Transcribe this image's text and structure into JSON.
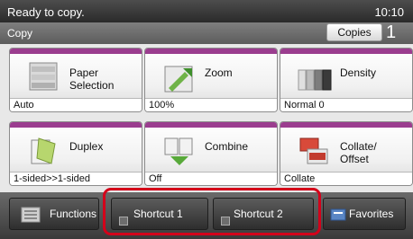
{
  "status": {
    "message": "Ready to copy.",
    "time": "10:10"
  },
  "title_bar": {
    "mode": "Copy",
    "copies_label": "Copies",
    "copies_count": "1"
  },
  "tiles": [
    {
      "label_line1": "Paper",
      "label_line2": "Selection",
      "value": "Auto",
      "icon": "paper-tray-icon"
    },
    {
      "label_line1": "Zoom",
      "label_line2": "",
      "value": "100%",
      "icon": "zoom-icon"
    },
    {
      "label_line1": "Density",
      "label_line2": "",
      "value": "Normal 0",
      "icon": "density-icon"
    },
    {
      "label_line1": "Duplex",
      "label_line2": "",
      "value": "1-sided>>1-sided",
      "icon": "duplex-icon"
    },
    {
      "label_line1": "Combine",
      "label_line2": "",
      "value": "Off",
      "icon": "combine-icon"
    },
    {
      "label_line1": "Collate/",
      "label_line2": "Offset",
      "value": "Collate",
      "icon": "collate-icon"
    }
  ],
  "bottom": {
    "functions": "Functions",
    "shortcut1": "Shortcut 1",
    "shortcut2": "Shortcut 2",
    "favorites": "Favorites"
  },
  "colors": {
    "accent": "#9b3d8f",
    "highlight": "#d4001a"
  }
}
